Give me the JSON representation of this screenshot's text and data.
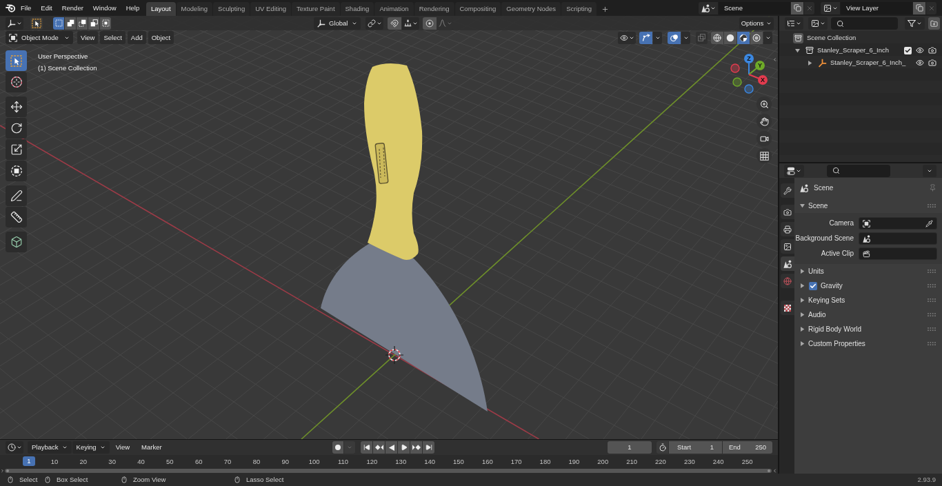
{
  "top_bar": {
    "menus": [
      "File",
      "Edit",
      "Render",
      "Window",
      "Help"
    ],
    "workspace_tabs": [
      {
        "label": "Layout",
        "selected": true
      },
      {
        "label": "Modeling",
        "selected": false
      },
      {
        "label": "Sculpting",
        "selected": false
      },
      {
        "label": "UV Editing",
        "selected": false
      },
      {
        "label": "Texture Paint",
        "selected": false
      },
      {
        "label": "Shading",
        "selected": false
      },
      {
        "label": "Animation",
        "selected": false
      },
      {
        "label": "Rendering",
        "selected": false
      },
      {
        "label": "Compositing",
        "selected": false
      },
      {
        "label": "Geometry Nodes",
        "selected": false
      },
      {
        "label": "Scripting",
        "selected": false
      }
    ],
    "scene": "Scene",
    "view_layer": "View Layer"
  },
  "viewport": {
    "header": {
      "select_modes": [
        {
          "selected": true
        },
        {
          "selected": false
        },
        {
          "selected": false
        },
        {
          "selected": false
        },
        {
          "selected": false
        }
      ],
      "orientation": "Global",
      "options": "Options",
      "mode": "Object Mode",
      "menus": [
        "View",
        "Select",
        "Add",
        "Object"
      ],
      "gizmos_on": true,
      "overlays_on": true,
      "xray_on": false,
      "shading_modes": [
        {
          "selected": false
        },
        {
          "selected": false
        },
        {
          "selected": true
        },
        {
          "selected": false
        }
      ]
    },
    "toolbar": [
      {
        "tools": [
          {
            "selected": true
          },
          {
            "selected": false
          }
        ]
      },
      {
        "tools": [
          {
            "selected": false
          },
          {
            "selected": false
          },
          {
            "selected": false
          },
          {
            "selected": false
          }
        ]
      },
      {
        "tools": [
          {
            "selected": false
          },
          {
            "selected": false
          }
        ]
      },
      {
        "tools": [
          {
            "selected": false
          }
        ]
      }
    ],
    "info": [
      "User Perspective",
      "(1) Scene Collection"
    ],
    "navigation_gizmo": [
      {
        "kind": "negative",
        "color": "#3b87e0"
      },
      {
        "kind": "negative",
        "color": "#6ea928"
      },
      {
        "kind": "negative",
        "color": "#e33b4e"
      },
      {
        "kind": "positive",
        "label": "Z",
        "color": "#3b87e0"
      },
      {
        "kind": "positive",
        "label": "Y",
        "color": "#6ea928"
      },
      {
        "kind": "positive",
        "label": "X",
        "color": "#e33b4e"
      }
    ]
  },
  "timeline": {
    "menus": [
      {
        "label": "Playback",
        "kind": "dropdown"
      },
      {
        "label": "Keying",
        "kind": "dropdown"
      },
      {
        "label": "View",
        "kind": "menu"
      },
      {
        "label": "Marker",
        "kind": "menu"
      }
    ],
    "auto_keying_on": false,
    "current_frame": "1",
    "start": {
      "label": "Start",
      "value": "1"
    },
    "end": {
      "label": "End",
      "value": "250"
    },
    "playhead": "1",
    "frame_labels": [
      "10",
      "20",
      "30",
      "40",
      "50",
      "60",
      "70",
      "80",
      "90",
      "100",
      "110",
      "120",
      "130",
      "140",
      "150",
      "160",
      "170",
      "180",
      "190",
      "200",
      "210",
      "220",
      "230",
      "240",
      "250"
    ]
  },
  "outliner": {
    "tree": [
      {
        "label": "Scene Collection",
        "kind": "scene_collection",
        "children": [
          {
            "label": "Stanley_Scraper_6_Inch",
            "kind": "collection",
            "expanded": true,
            "checked": true,
            "children": [
              {
                "label": "Stanley_Scraper_6_Inch_",
                "kind": "empty",
                "expanded": false
              }
            ]
          }
        ]
      }
    ]
  },
  "properties": {
    "tab_groups": [
      {
        "tabs": [
          {
            "selected": false
          }
        ]
      },
      {
        "tabs": [
          {
            "selected": false
          },
          {
            "selected": false
          },
          {
            "selected": false
          },
          {
            "selected": true
          },
          {
            "selected": false
          }
        ]
      },
      {
        "tabs": [
          {
            "selected": false
          }
        ]
      }
    ],
    "context": "Scene",
    "panels": [
      {
        "title": "Scene",
        "expanded": true,
        "fields": [
          {
            "label": "Camera",
            "kind": "object"
          },
          {
            "label": "Background Scene",
            "kind": "scene"
          },
          {
            "label": "Active Clip",
            "kind": "clip"
          }
        ]
      },
      {
        "title": "Units",
        "expanded": false
      },
      {
        "title": "Gravity",
        "expanded": false,
        "checked": true
      },
      {
        "title": "Keying Sets",
        "expanded": false
      },
      {
        "title": "Audio",
        "expanded": false
      },
      {
        "title": "Rigid Body World",
        "expanded": false
      },
      {
        "title": "Custom Properties",
        "expanded": false
      }
    ]
  },
  "status_bar": {
    "hints": [
      "Select",
      "Box Select",
      "Zoom View",
      "Lasso Select"
    ],
    "version": "2.93.9"
  }
}
